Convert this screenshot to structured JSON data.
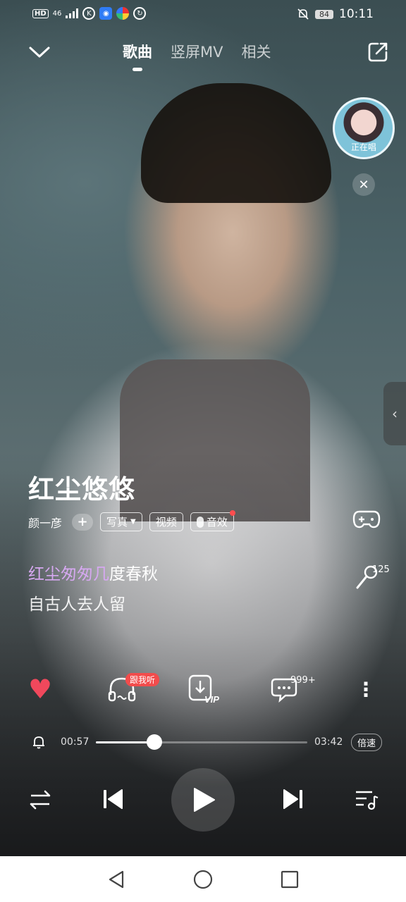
{
  "status_bar": {
    "hd": "HD",
    "signal": "46",
    "battery": "84",
    "time": "10:11"
  },
  "top_nav": {
    "tabs": [
      "歌曲",
      "竖屏MV",
      "相关"
    ],
    "active_tab": 0
  },
  "singing_float": {
    "label": "正在唱"
  },
  "song": {
    "title": "红尘悠悠",
    "artist": "颜一彦",
    "follow": "+",
    "chips": {
      "photo": "写真",
      "video": "视频",
      "effect": "音效"
    }
  },
  "lyrics": {
    "current_highlight": "红尘匆匆几",
    "current_rest": "度春秋",
    "next": "自古人去人留"
  },
  "karaoke": {
    "count": "125"
  },
  "actions": {
    "listen_badge": "跟我听",
    "download_vip": "VIP",
    "comment_count": "999+"
  },
  "progress": {
    "current": "00:57",
    "total": "03:42",
    "fraction": 0.276,
    "speed_label": "倍速"
  },
  "colors": {
    "heart": "#f0485c",
    "lyric_highlight": "#d6a8f0",
    "badge": "#f24c4c"
  },
  "icons": {
    "back": "chevron-down-icon",
    "share": "share-icon",
    "game": "gamepad-icon",
    "mic": "microphone-icon",
    "heart": "heart-icon",
    "listen": "headphones-icon",
    "download": "download-vip-icon",
    "comment": "comment-icon",
    "more": "more-vertical-icon",
    "bell": "bell-icon",
    "mode": "repeat-icon",
    "prev": "previous-icon",
    "play": "play-icon",
    "next": "next-icon",
    "playlist": "playlist-icon"
  }
}
